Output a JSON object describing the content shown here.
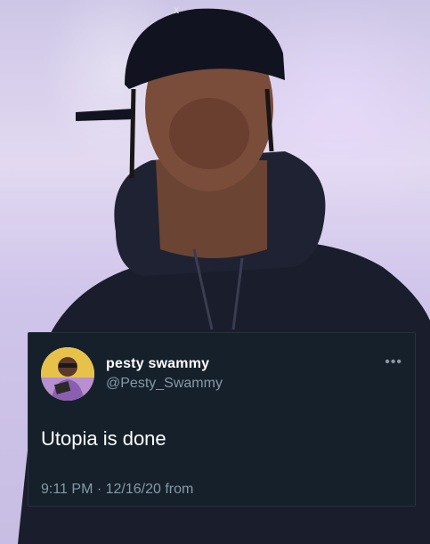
{
  "background": {
    "icon": "person-photo"
  },
  "tweet": {
    "display_name": "pesty swammy",
    "handle": "@Pesty_Swammy",
    "text": "Utopia is done",
    "meta": "9:11 PM · 12/16/20 from",
    "more_icon": "ellipsis-icon",
    "colors": {
      "card": "#15202b",
      "text": "#ffffff",
      "muted": "#8899a6"
    }
  }
}
